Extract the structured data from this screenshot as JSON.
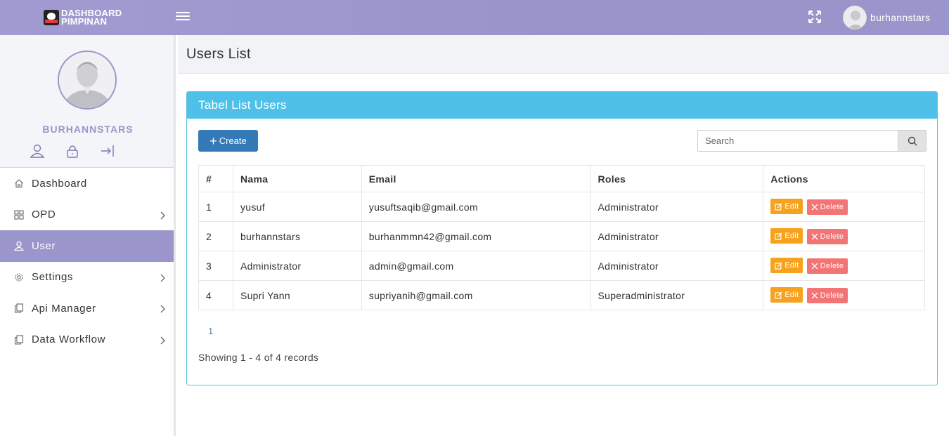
{
  "header": {
    "logo_line1": "DASHBOARD",
    "logo_line2": "PIMPINAN",
    "username": "burhannstars"
  },
  "sidebar": {
    "profile_name": "BURHANNSTARS",
    "items": [
      {
        "label": "Dashboard",
        "icon": "home-icon",
        "has_children": false,
        "active": false
      },
      {
        "label": "OPD",
        "icon": "grid-icon",
        "has_children": true,
        "active": false
      },
      {
        "label": "User",
        "icon": "user-icon",
        "has_children": false,
        "active": true
      },
      {
        "label": "Settings",
        "icon": "gear-icon",
        "has_children": true,
        "active": false
      },
      {
        "label": "Api Manager",
        "icon": "document-icon",
        "has_children": true,
        "active": false
      },
      {
        "label": "Data Workflow",
        "icon": "document-icon",
        "has_children": true,
        "active": false
      }
    ]
  },
  "page": {
    "title": "Users List",
    "panel_title": "Tabel List Users",
    "create_label": "Create",
    "search_placeholder": "Search",
    "table": {
      "headers": [
        "#",
        "Nama",
        "Email",
        "Roles",
        "Actions"
      ],
      "rows": [
        [
          "1",
          "yusuf",
          "yusuftsaqib@gmail.com",
          "Administrator"
        ],
        [
          "2",
          "burhannstars",
          "burhanmmn42@gmail.com",
          "Administrator"
        ],
        [
          "3",
          "Administrator",
          "admin@gmail.com",
          "Administrator"
        ],
        [
          "4",
          "Supri Yann",
          "supriyanih@gmail.com",
          "Superadministrator"
        ]
      ],
      "edit_label": "Edit",
      "delete_label": "Delete"
    },
    "pagination_current": "1",
    "records_text": "Showing 1 - 4 of 4 records"
  }
}
